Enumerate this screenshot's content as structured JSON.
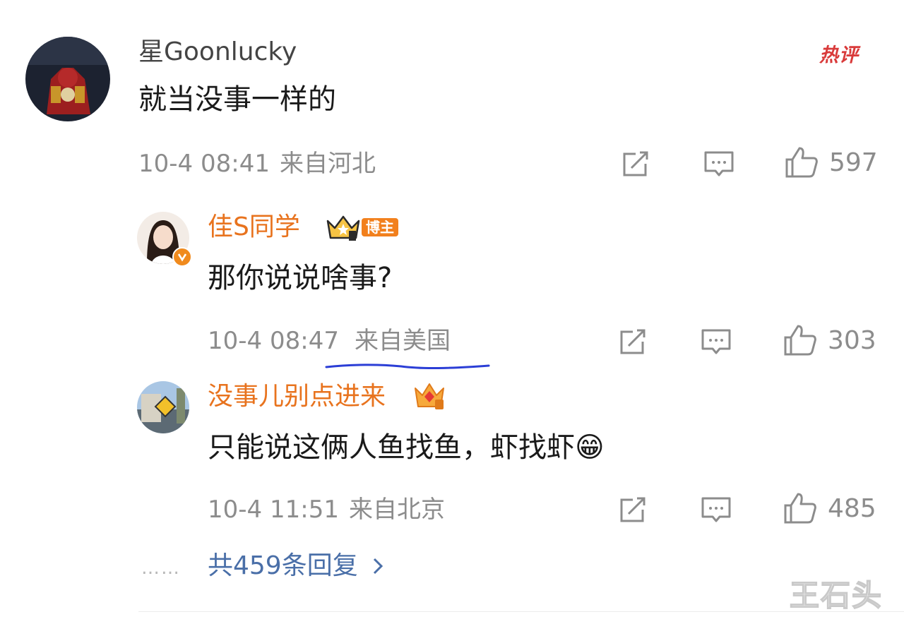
{
  "comment": {
    "username": "星Goonlucky",
    "text": "就当没事一样的",
    "time": "10-4 08:41",
    "location": "来自河北",
    "likes": "597",
    "hot_label": "热评",
    "replies": [
      {
        "username": "佳S同学",
        "badge": "博主",
        "text": "那你说说啥事?",
        "time": "10-4 08:47",
        "location": "来自美国",
        "likes": "303"
      },
      {
        "username": "没事儿别点进来",
        "text": "只能说这俩人鱼找鱼，虾找虾",
        "emoji": "😁",
        "time": "10-4 11:51",
        "location": "来自北京",
        "likes": "485"
      }
    ],
    "more_replies": "共459条回复",
    "dots": "……"
  },
  "watermark": "王石头",
  "colors": {
    "orange_name": "#e8731e",
    "link_blue": "#4a6fa8",
    "hot_red": "#d93a3a",
    "annotation_line": "#2b3ed6"
  },
  "icons": [
    "share-icon",
    "comment-icon",
    "like-icon",
    "crown-badge-icon",
    "verified-icon",
    "chevron-right-icon"
  ]
}
